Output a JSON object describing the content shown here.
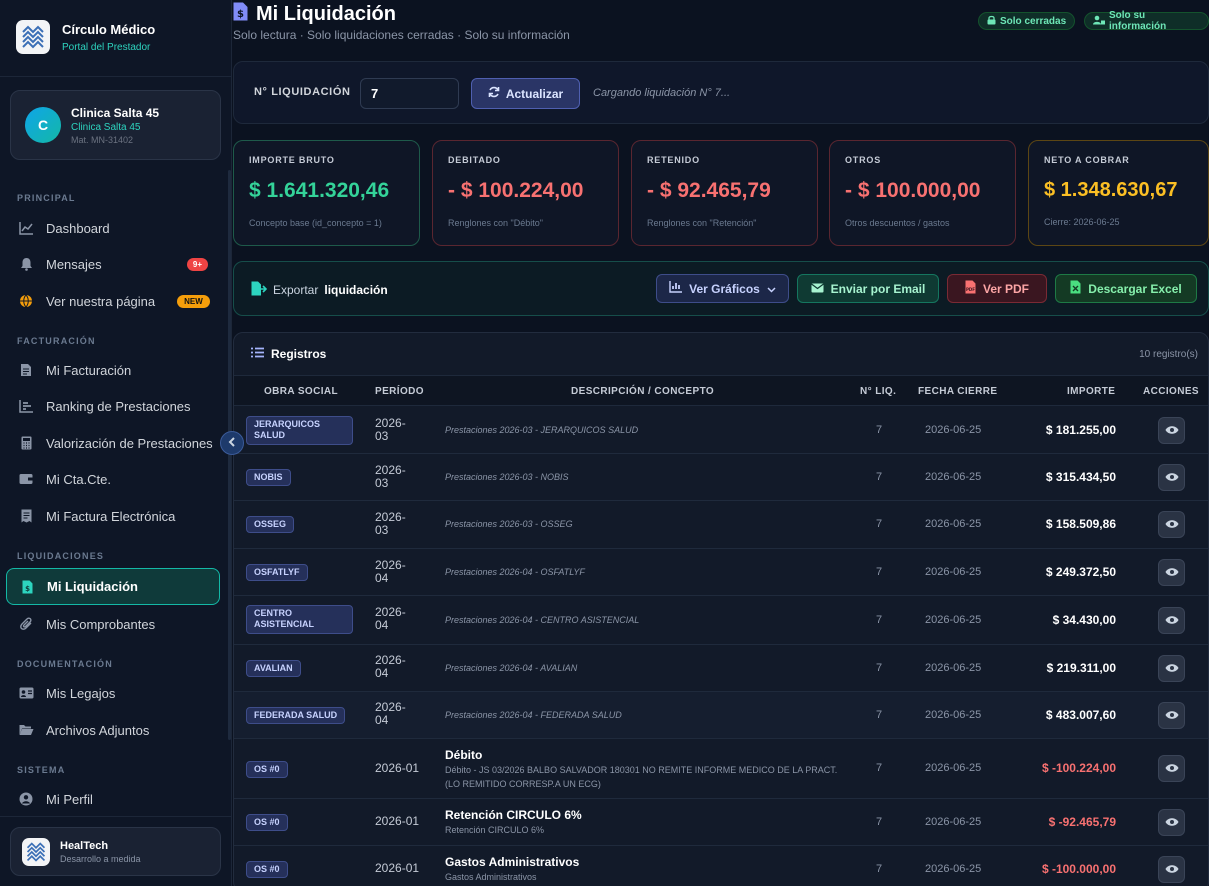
{
  "app": {
    "title": "Círculo Médico",
    "subtitle": "Portal del Prestador"
  },
  "user": {
    "initial": "C",
    "name": "Clinica Salta 45",
    "subname": "Clinica Salta 45",
    "mat": "Mat. MN-31402"
  },
  "sidebar": {
    "sections": {
      "principal": "PRINCIPAL",
      "facturacion": "FACTURACIÓN",
      "liquidaciones": "LIQUIDACIONES",
      "documentacion": "DOCUMENTACIÓN",
      "sistema": "SISTEMA"
    },
    "items": {
      "dashboard": "Dashboard",
      "mensajes": "Mensajes",
      "mensajes_badge": "9+",
      "pagina": "Ver nuestra página",
      "pagina_badge": "NEW",
      "facturacion": "Mi Facturación",
      "ranking": "Ranking de Prestaciones",
      "valorizacion": "Valorización de Prestaciones",
      "ctacte": "Mi Cta.Cte.",
      "factura_electronica": "Mi Factura Electrónica",
      "liquidacion": "Mi Liquidación",
      "comprobantes": "Mis Comprobantes",
      "legajos": "Mis Legajos",
      "adjuntos": "Archivos Adjuntos",
      "perfil": "Mi Perfil"
    }
  },
  "footer": {
    "name": "HealTech",
    "tagline": "Desarrollo a medida"
  },
  "page": {
    "title": "Mi Liquidación",
    "subtitle": "Solo lectura · Solo liquidaciones cerradas · Solo su información",
    "pill_closed": "Solo cerradas",
    "pill_info": "Solo su información"
  },
  "liq": {
    "label": "N° LIQUIDACIÓN",
    "value": "7",
    "button": "Actualizar",
    "status": "Cargando liquidación N° 7..."
  },
  "colors": {
    "bruto": "#34d399",
    "debitado": "#f87171",
    "retenido": "#f87171",
    "otros": "#f87171",
    "neto": "#fbbf24",
    "accent": "#14b8a6"
  },
  "cards": {
    "bruto": {
      "label": "IMPORTE BRUTO",
      "value": "$ 1.641.320,46",
      "desc": "Concepto base (id_concepto = 1)"
    },
    "debitado": {
      "label": "DEBITADO",
      "value": "- $ 100.224,00",
      "desc": "Renglones con \"Débito\""
    },
    "retenido": {
      "label": "RETENIDO",
      "value": "- $ 92.465,79",
      "desc": "Renglones con \"Retención\""
    },
    "otros": {
      "label": "OTROS",
      "value": "- $ 100.000,00",
      "desc": "Otros descuentos / gastos"
    },
    "neto": {
      "label": "NETO A COBRAR",
      "value": "$ 1.348.630,67",
      "desc": "Cierre: 2026-06-25"
    }
  },
  "export": {
    "prefix": "Exportar",
    "bold": "liquidación",
    "graficos": "Ver Gráficos",
    "email": "Enviar por Email",
    "pdf": "Ver PDF",
    "excel": "Descargar Excel"
  },
  "table": {
    "title": "Registros",
    "count": "10 registro(s)",
    "headers": {
      "obra": "OBRA SOCIAL",
      "periodo": "PERÍODO",
      "desc": "DESCRIPCIÓN / CONCEPTO",
      "nliq": "N° LIQ.",
      "fecha": "FECHA CIERRE",
      "importe": "IMPORTE",
      "acciones": "ACCIONES"
    },
    "rows": [
      {
        "obra": "JERARQUICOS SALUD",
        "periodo": "2026-03",
        "desc": "Prestaciones 2026-03 - JERARQUICOS SALUD",
        "nliq": "7",
        "fecha": "2026-06-25",
        "importe": "$ 181.255,00"
      },
      {
        "obra": "NOBIS",
        "periodo": "2026-03",
        "desc": "Prestaciones 2026-03 - NOBIS",
        "nliq": "7",
        "fecha": "2026-06-25",
        "importe": "$ 315.434,50"
      },
      {
        "obra": "OSSEG",
        "periodo": "2026-03",
        "desc": "Prestaciones 2026-03 - OSSEG",
        "nliq": "7",
        "fecha": "2026-06-25",
        "importe": "$ 158.509,86"
      },
      {
        "obra": "OSFATLYF",
        "periodo": "2026-04",
        "desc": "Prestaciones 2026-04 - OSFATLYF",
        "nliq": "7",
        "fecha": "2026-06-25",
        "importe": "$ 249.372,50"
      },
      {
        "obra": "CENTRO ASISTENCIAL",
        "periodo": "2026-04",
        "desc": "Prestaciones 2026-04 - CENTRO ASISTENCIAL",
        "nliq": "7",
        "fecha": "2026-06-25",
        "importe": "$ 34.430,00"
      },
      {
        "obra": "AVALIAN",
        "periodo": "2026-04",
        "desc": "Prestaciones 2026-04 - AVALIAN",
        "nliq": "7",
        "fecha": "2026-06-25",
        "importe": "$ 219.311,00"
      },
      {
        "obra": "FEDERADA SALUD",
        "periodo": "2026-04",
        "desc": "Prestaciones 2026-04 - FEDERADA SALUD",
        "nliq": "7",
        "fecha": "2026-06-25",
        "importe": "$ 483.007,60"
      },
      {
        "obra": "OS #0",
        "periodo": "2026-01",
        "title": "Débito",
        "desc": "Débito - JS 03/2026 BALBO SALVADOR 180301 NO REMITE INFORME MEDICO DE LA PRACT.(LO REMITIDO CORRESP.A UN ECG)",
        "nliq": "7",
        "fecha": "2026-06-25",
        "importe": "$ -100.224,00"
      },
      {
        "obra": "OS #0",
        "periodo": "2026-01",
        "title": "Retención CIRCULO 6%",
        "desc": "Retención CIRCULO 6%",
        "nliq": "7",
        "fecha": "2026-06-25",
        "importe": "$ -92.465,79"
      },
      {
        "obra": "OS #0",
        "periodo": "2026-01",
        "title": "Gastos Administrativos",
        "desc": "Gastos Administrativos",
        "nliq": "7",
        "fecha": "2026-06-25",
        "importe": "$ -100.000,00"
      }
    ]
  }
}
